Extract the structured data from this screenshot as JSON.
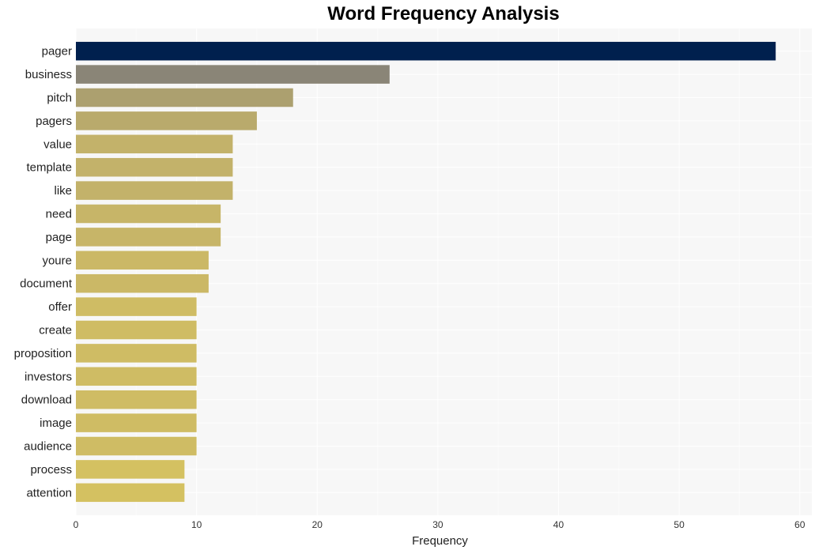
{
  "chart_data": {
    "type": "bar",
    "orientation": "horizontal",
    "title": "Word Frequency Analysis",
    "xlabel": "Frequency",
    "ylabel": "",
    "xlim": [
      0,
      61
    ],
    "xticks": [
      0,
      10,
      20,
      30,
      40,
      50,
      60
    ],
    "grid": true,
    "categories": [
      "pager",
      "business",
      "pitch",
      "pagers",
      "value",
      "template",
      "like",
      "need",
      "page",
      "youre",
      "document",
      "offer",
      "create",
      "proposition",
      "investors",
      "download",
      "image",
      "audience",
      "process",
      "attention"
    ],
    "values": [
      58,
      26,
      18,
      15,
      13,
      13,
      13,
      12,
      12,
      11,
      11,
      10,
      10,
      10,
      10,
      10,
      10,
      10,
      9,
      9
    ],
    "colors": [
      "#00204e",
      "#8a8577",
      "#aca06f",
      "#b9aa6c",
      "#c3b26a",
      "#c3b26a",
      "#c3b26a",
      "#c7b568",
      "#c7b568",
      "#cbb866",
      "#cbb866",
      "#cfbc64",
      "#cfbc64",
      "#cfbc64",
      "#cfbc64",
      "#cfbc64",
      "#cfbc64",
      "#cfbc64",
      "#d4c161",
      "#d4c161"
    ],
    "plot_background": "#f7f7f7"
  }
}
